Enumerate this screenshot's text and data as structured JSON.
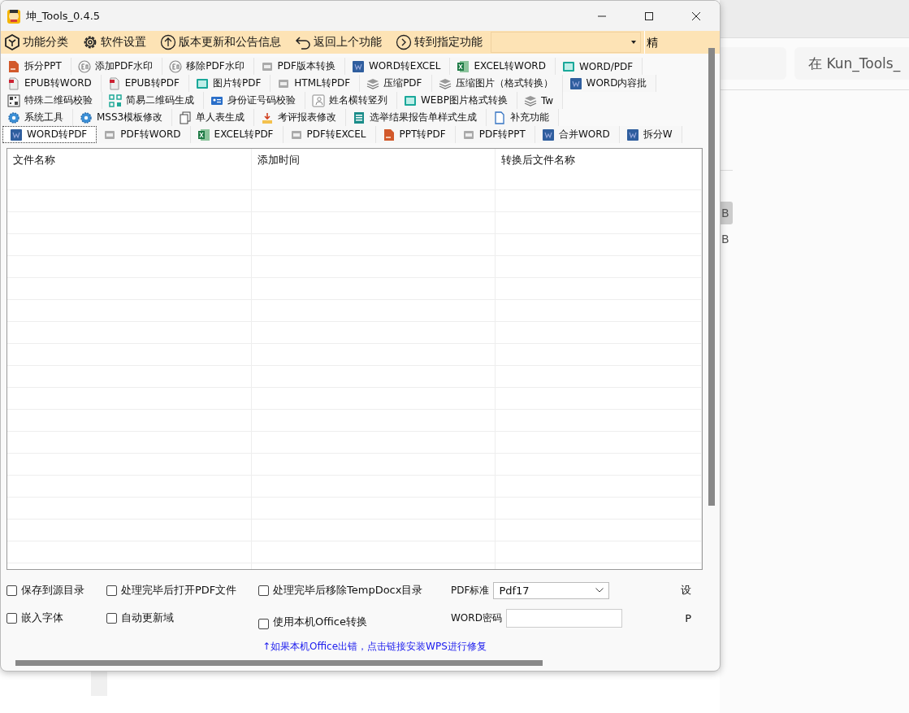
{
  "background_window": {
    "search_text": "在 Kun_Tools_",
    "items": [
      {
        "label": "B",
        "selected": true
      },
      {
        "label": "B",
        "selected": false
      }
    ]
  },
  "window": {
    "title": "坤_Tools_0.4.5"
  },
  "toolbar": {
    "items": [
      {
        "label": "功能分类"
      },
      {
        "label": "软件设置"
      },
      {
        "label": "版本更新和公告信息"
      },
      {
        "label": "返回上个功能"
      },
      {
        "label": "转到指定功能"
      }
    ],
    "cut_button": "精"
  },
  "tab_rows": [
    [
      {
        "label": "拆分PPT",
        "kind": "ppt",
        "selected": false
      },
      {
        "label": "添加PDF水印",
        "kind": "en",
        "selected": false
      },
      {
        "label": "移除PDF水印",
        "kind": "en",
        "selected": false
      },
      {
        "label": "PDF版本转换",
        "kind": "pdf",
        "selected": false
      },
      {
        "label": "WORD转EXCEL",
        "kind": "word",
        "selected": false
      },
      {
        "label": "EXCEL转WORD",
        "kind": "excel",
        "selected": false
      },
      {
        "label": "WORD/PDF",
        "kind": "image",
        "selected": false
      }
    ],
    [
      {
        "label": "EPUB转WORD",
        "kind": "epub",
        "selected": false
      },
      {
        "label": "EPUB转PDF",
        "kind": "epub",
        "selected": false
      },
      {
        "label": "图片转PDF",
        "kind": "image",
        "selected": false
      },
      {
        "label": "HTML转PDF",
        "kind": "pdf",
        "selected": false
      },
      {
        "label": "压缩PDF",
        "kind": "compress",
        "selected": false
      },
      {
        "label": "压缩图片（格式转换）",
        "kind": "compress",
        "selected": false
      },
      {
        "label": "WORD内容批",
        "kind": "word",
        "selected": false
      }
    ],
    [
      {
        "label": "特殊二维码校验",
        "kind": "qr",
        "selected": false
      },
      {
        "label": "简易二维码生成",
        "kind": "qr2",
        "selected": false
      },
      {
        "label": "身份证号码校验",
        "kind": "id",
        "selected": false
      },
      {
        "label": "姓名横转竖列",
        "kind": "person",
        "selected": false
      },
      {
        "label": "WEBP图片格式转换",
        "kind": "image",
        "selected": false
      },
      {
        "label": "Tw",
        "kind": "compress",
        "selected": false
      }
    ],
    [
      {
        "label": "系统工具",
        "kind": "gear",
        "selected": false
      },
      {
        "label": "MSS3模板修改",
        "kind": "gear",
        "selected": false
      },
      {
        "label": "单人表生成",
        "kind": "doc",
        "selected": false
      },
      {
        "label": "考评报表修改",
        "kind": "report",
        "selected": false
      },
      {
        "label": "选举结果报告单样式生成",
        "kind": "list",
        "selected": false
      },
      {
        "label": "补充功能",
        "kind": "file",
        "selected": false
      }
    ],
    [
      {
        "label": "WORD转PDF",
        "kind": "word",
        "selected": true
      },
      {
        "label": "PDF转WORD",
        "kind": "pdf",
        "selected": false
      },
      {
        "label": "EXCEL转PDF",
        "kind": "excel",
        "selected": false
      },
      {
        "label": "PDF转EXCEL",
        "kind": "pdf",
        "selected": false
      },
      {
        "label": "PPT转PDF",
        "kind": "ppt",
        "selected": false
      },
      {
        "label": "PDF转PPT",
        "kind": "pdf",
        "selected": false
      },
      {
        "label": "合并WORD",
        "kind": "word",
        "selected": false
      },
      {
        "label": "拆分W",
        "kind": "word",
        "selected": false
      }
    ]
  ],
  "table": {
    "columns": [
      "文件名称",
      "添加时间",
      "转换后文件名称"
    ]
  },
  "options": {
    "rows": [
      [
        {
          "kind": "checkbox",
          "label": "保存到源目录",
          "checked": false
        },
        {
          "kind": "checkbox",
          "label": "处理完毕后打开PDF文件",
          "checked": false
        },
        {
          "kind": "checkbox",
          "label": "处理完毕后移除TempDocx目录",
          "checked": false
        },
        {
          "kind": "select",
          "label": "PDF标准",
          "value": "Pdf17"
        },
        {
          "kind": "cut",
          "label": "设"
        }
      ],
      [
        {
          "kind": "checkbox",
          "label": "嵌入字体",
          "checked": false
        },
        {
          "kind": "checkbox",
          "label": "自动更新域",
          "checked": false
        },
        {
          "kind": "checkbox",
          "label": "使用本机Office转换",
          "checked": false
        },
        {
          "kind": "input",
          "label": "WORD密码"
        },
        {
          "kind": "cut",
          "label": "P"
        }
      ]
    ]
  },
  "link": {
    "text": "↑如果本机Office出错，点击链接安装WPS进行修复"
  }
}
